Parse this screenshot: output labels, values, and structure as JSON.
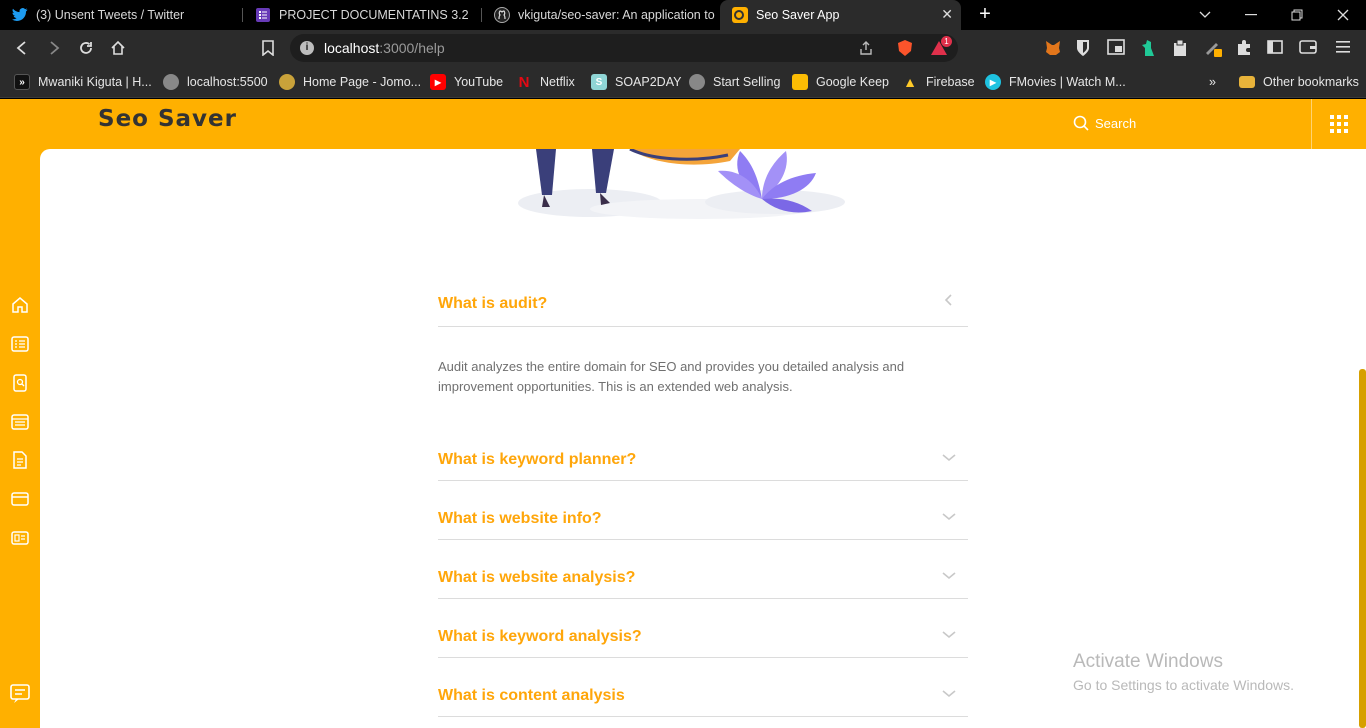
{
  "browser": {
    "tabs": [
      {
        "title": "(3) Unsent Tweets / Twitter",
        "icon": "twitter-icon"
      },
      {
        "title": "PROJECT DOCUMENTATINS 3.2",
        "icon": "docs-icon"
      },
      {
        "title": "vkiguta/seo-saver: An application to st",
        "icon": "github-icon"
      },
      {
        "title": "Seo Saver App",
        "icon": "seo-saver-icon",
        "active": true
      }
    ],
    "new_tab": "+",
    "url_host": "localhost",
    "url_path": ":3000/help",
    "bookmarks": [
      {
        "label": "Mwaniki Kiguta | H...",
        "icon": "profile-icon"
      },
      {
        "label": "localhost:5500",
        "icon": "globe-icon"
      },
      {
        "label": "Home Page - Jomo...",
        "icon": "jomo-icon"
      },
      {
        "label": "YouTube",
        "icon": "youtube-icon"
      },
      {
        "label": "Netflix",
        "icon": "netflix-icon"
      },
      {
        "label": "SOAP2DAY",
        "icon": "soap2day-icon"
      },
      {
        "label": "Start Selling",
        "icon": "globe-icon"
      },
      {
        "label": "Google Keep",
        "icon": "keep-icon"
      },
      {
        "label": "Firebase",
        "icon": "firebase-icon"
      },
      {
        "label": "FMovies | Watch M...",
        "icon": "fmovies-icon"
      }
    ],
    "bookmarks_more": "»",
    "other_bookmarks": "Other bookmarks",
    "brave_badge": "1"
  },
  "app": {
    "logo": "Seo Saver",
    "search_label": "Search",
    "accent_color": "#ffb000",
    "question_color": "#ffa60a"
  },
  "faq": [
    {
      "question": "What is audit?",
      "expanded": true,
      "answer": "Audit analyzes the entire domain for SEO and provides you detailed analysis and improvement opportunities. This is an extended web analysis."
    },
    {
      "question": "What is keyword planner?",
      "expanded": false
    },
    {
      "question": "What is website info?",
      "expanded": false
    },
    {
      "question": "What is website analysis?",
      "expanded": false
    },
    {
      "question": "What is keyword analysis?",
      "expanded": false
    },
    {
      "question": "What is content analysis",
      "expanded": false
    }
  ],
  "watermark": {
    "line1": "Activate Windows",
    "line2": "Go to Settings to activate Windows."
  }
}
